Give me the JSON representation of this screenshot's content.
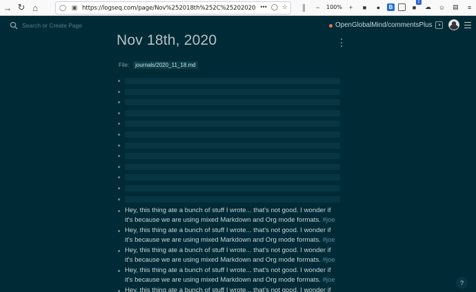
{
  "browser": {
    "url": "https://logseq.com/page/Nov%252018th%252C%25202020",
    "zoom": "100%",
    "notification_badge": "1"
  },
  "header": {
    "search_placeholder": "Search or Create Page",
    "repo_name": "OpenGlobalMind/commentsPlus"
  },
  "page": {
    "title": "Nov 18th, 2020",
    "file_label": "File:",
    "file_path": "journals/2020_11_18.md"
  },
  "blocks": {
    "empty_count": 12,
    "text_blocks": [
      {
        "line1": "Hey, this thing ate a bunch of stuff I wrote... that's not good. I wonder if",
        "line2": "it's because we are using mixed Markdown and Org mode formats.",
        "tag": "#joe"
      },
      {
        "line1": "Hey, this thing ate a bunch of stuff I wrote... that's not good. I wonder if",
        "line2": "it's because we are using mixed Markdown and Org mode formats.",
        "tag": "#joe"
      },
      {
        "line1": "Hey, this thing ate a bunch of stuff I wrote... that's not good. I wonder if",
        "line2": "it's because we are using mixed Markdown and Org mode formats.",
        "tag": "#joe"
      },
      {
        "line1": "Hey, this thing ate a bunch of stuff I wrote... that's not good. I wonder if",
        "line2": "it's because we are using mixed Markdown and Org mode formats.",
        "tag": "#joe"
      },
      {
        "line1": "Hey, this thing ate a bunch of stuff I wrote... that's not good. I wonder if",
        "line2": "",
        "tag": ""
      }
    ]
  },
  "help": {
    "label": "?"
  },
  "colors": {
    "background": "#002b36",
    "block_bg": "#073642",
    "accent": "#e8754b",
    "tag": "#5b8fa6"
  }
}
